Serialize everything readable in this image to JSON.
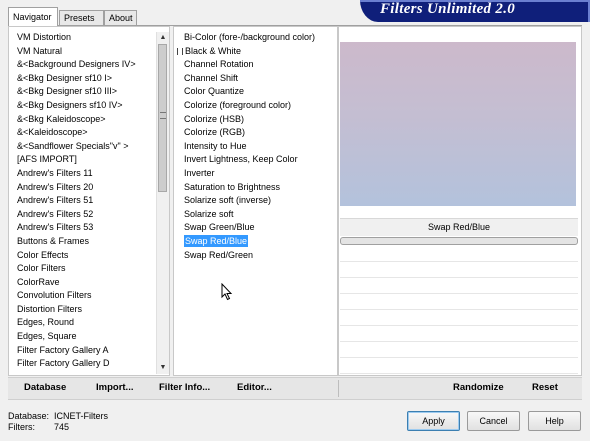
{
  "title": "Filters Unlimited 2.0",
  "tabs": [
    {
      "label": "Navigator",
      "active": true
    },
    {
      "label": "Presets",
      "active": false
    },
    {
      "label": "About",
      "active": false
    }
  ],
  "categories": [
    "VM Distortion",
    "VM Natural",
    "&<Background Designers IV>",
    "&<Bkg Designer sf10 I>",
    "&<Bkg Designer sf10 III>",
    "&<Bkg Designers sf10 IV>",
    "&<Bkg Kaleidoscope>",
    "&<Kaleidoscope>",
    "&<Sandflower Specials\"v\" >",
    "[AFS IMPORT]",
    "Andrew's Filters 11",
    "Andrew's Filters 20",
    "Andrew's Filters 51",
    "Andrew's Filters 52",
    "Andrew's Filters 53",
    "Buttons & Frames",
    "Color Effects",
    "Color Filters",
    "ColorRave",
    "Convolution Filters",
    "Distortion Filters",
    "Edges, Round",
    "Edges, Square",
    "Filter Factory Gallery A",
    "Filter Factory Gallery D"
  ],
  "filters": [
    "Bi-Color (fore-/background color)",
    "Black & White",
    "Channel Rotation",
    "Channel Shift",
    "Color Quantize",
    "Colorize (foreground color)",
    "Colorize (HSB)",
    "Colorize (RGB)",
    "Intensity to Hue",
    "Invert Lightness, Keep Color",
    "Inverter",
    "Saturation to Brightness",
    "Solarize soft (inverse)",
    "Solarize soft",
    "Swap Green/Blue",
    "Swap Red/Blue",
    "Swap Red/Green"
  ],
  "selected_filter": "Swap Red/Blue",
  "preview_filter_name": "Swap Red/Blue",
  "toolbar": {
    "database": "Database",
    "import": "Import...",
    "filter_info": "Filter Info...",
    "editor": "Editor...",
    "randomize": "Randomize",
    "reset": "Reset"
  },
  "status": {
    "database_label": "Database:",
    "database_value": "ICNET-Filters",
    "filters_label": "Filters:",
    "filters_value": "745"
  },
  "buttons": {
    "apply": "Apply",
    "cancel": "Cancel",
    "help": "Help"
  },
  "colors": {
    "banner": "#0f1f7a",
    "selection": "#3399ff"
  }
}
